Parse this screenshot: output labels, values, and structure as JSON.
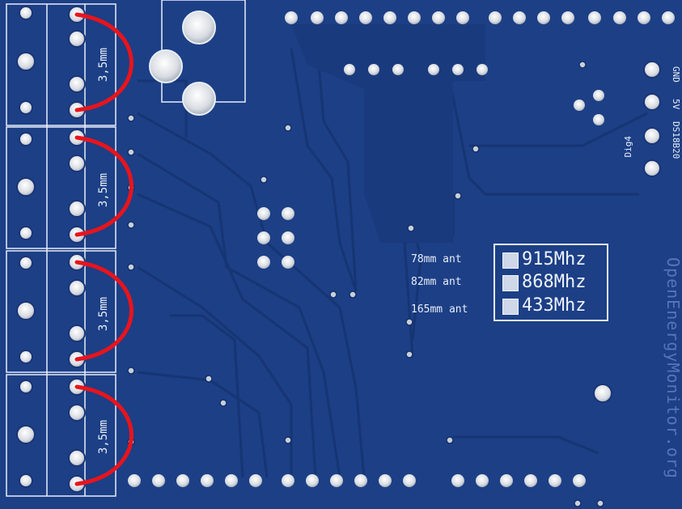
{
  "board": {
    "jack_size_label": "3,5mm",
    "frequency_options": [
      {
        "freq": "915Mhz",
        "antenna": "78mm ant"
      },
      {
        "freq": "868Mhz",
        "antenna": "82mm ant"
      },
      {
        "freq": "433Mhz",
        "antenna": "165mm ant"
      }
    ],
    "header_labels": {
      "gnd": "GND",
      "fivev": "5V",
      "ds18b20": "DS18B20",
      "dig4": "Dig4"
    },
    "brand_watermark": "OpenEnergyMonitor.org"
  },
  "colors": {
    "pcb": "#1c3f86",
    "trace": "#173571",
    "silkscreen": "#e8eef8",
    "pad": "#d4d8de",
    "marker": "#e8141c"
  }
}
